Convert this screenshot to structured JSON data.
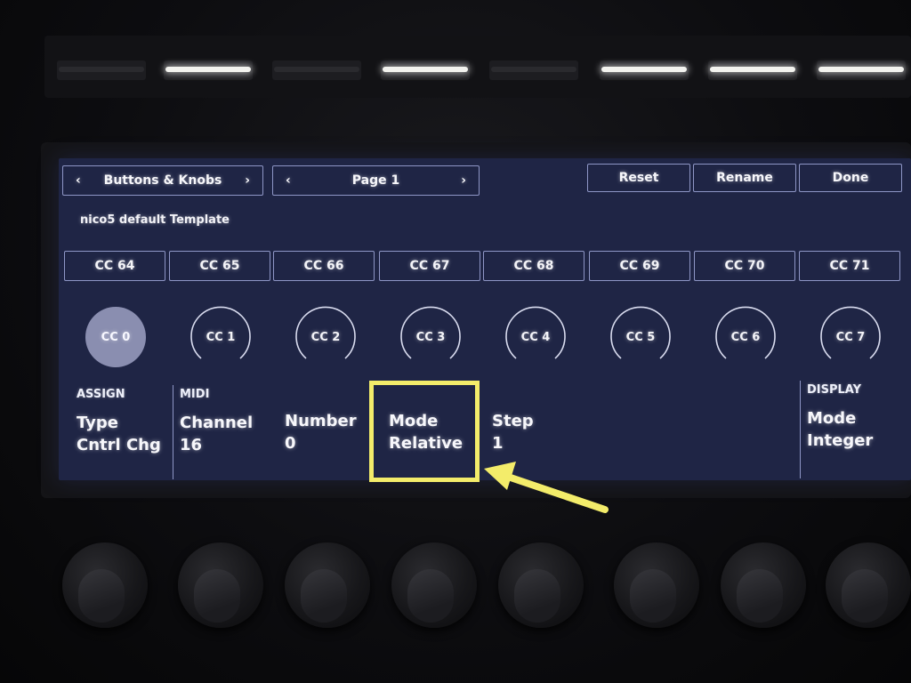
{
  "header": {
    "section_nav": {
      "prev": "‹",
      "label": "Buttons & Knobs",
      "next": "›"
    },
    "page_nav": {
      "prev": "‹",
      "label": "Page 1",
      "next": "›"
    },
    "reset_label": "Reset",
    "rename_label": "Rename",
    "done_label": "Done"
  },
  "template_name": "nico5 default Template",
  "button_ccs": [
    "CC 64",
    "CC 65",
    "CC 66",
    "CC 67",
    "CC 68",
    "CC 69",
    "CC 70",
    "CC 71"
  ],
  "knobs": [
    {
      "label": "CC 0",
      "selected": true
    },
    {
      "label": "CC 1",
      "selected": false
    },
    {
      "label": "CC 2",
      "selected": false
    },
    {
      "label": "CC 3",
      "selected": false
    },
    {
      "label": "CC 4",
      "selected": false
    },
    {
      "label": "CC 5",
      "selected": false
    },
    {
      "label": "CC 6",
      "selected": false
    },
    {
      "label": "CC 7",
      "selected": false
    }
  ],
  "assign": {
    "heading": "ASSIGN",
    "type_label": "Type",
    "type_value": "Cntrl Chg"
  },
  "midi": {
    "heading": "MIDI",
    "channel_label": "Channel",
    "channel_value": "16",
    "number_label": "Number",
    "number_value": "0",
    "mode_label": "Mode",
    "mode_value": "Relative",
    "step_label": "Step",
    "step_value": "1"
  },
  "display": {
    "heading": "DISPLAY",
    "mode_label": "Mode",
    "mode_value": "Integer"
  },
  "pads_lit": [
    false,
    true,
    false,
    true,
    false,
    true,
    true,
    true
  ],
  "colors": {
    "screen_bg": "#1f2545",
    "outline": "#8e96c6",
    "annotation": "#f3ec6a"
  }
}
